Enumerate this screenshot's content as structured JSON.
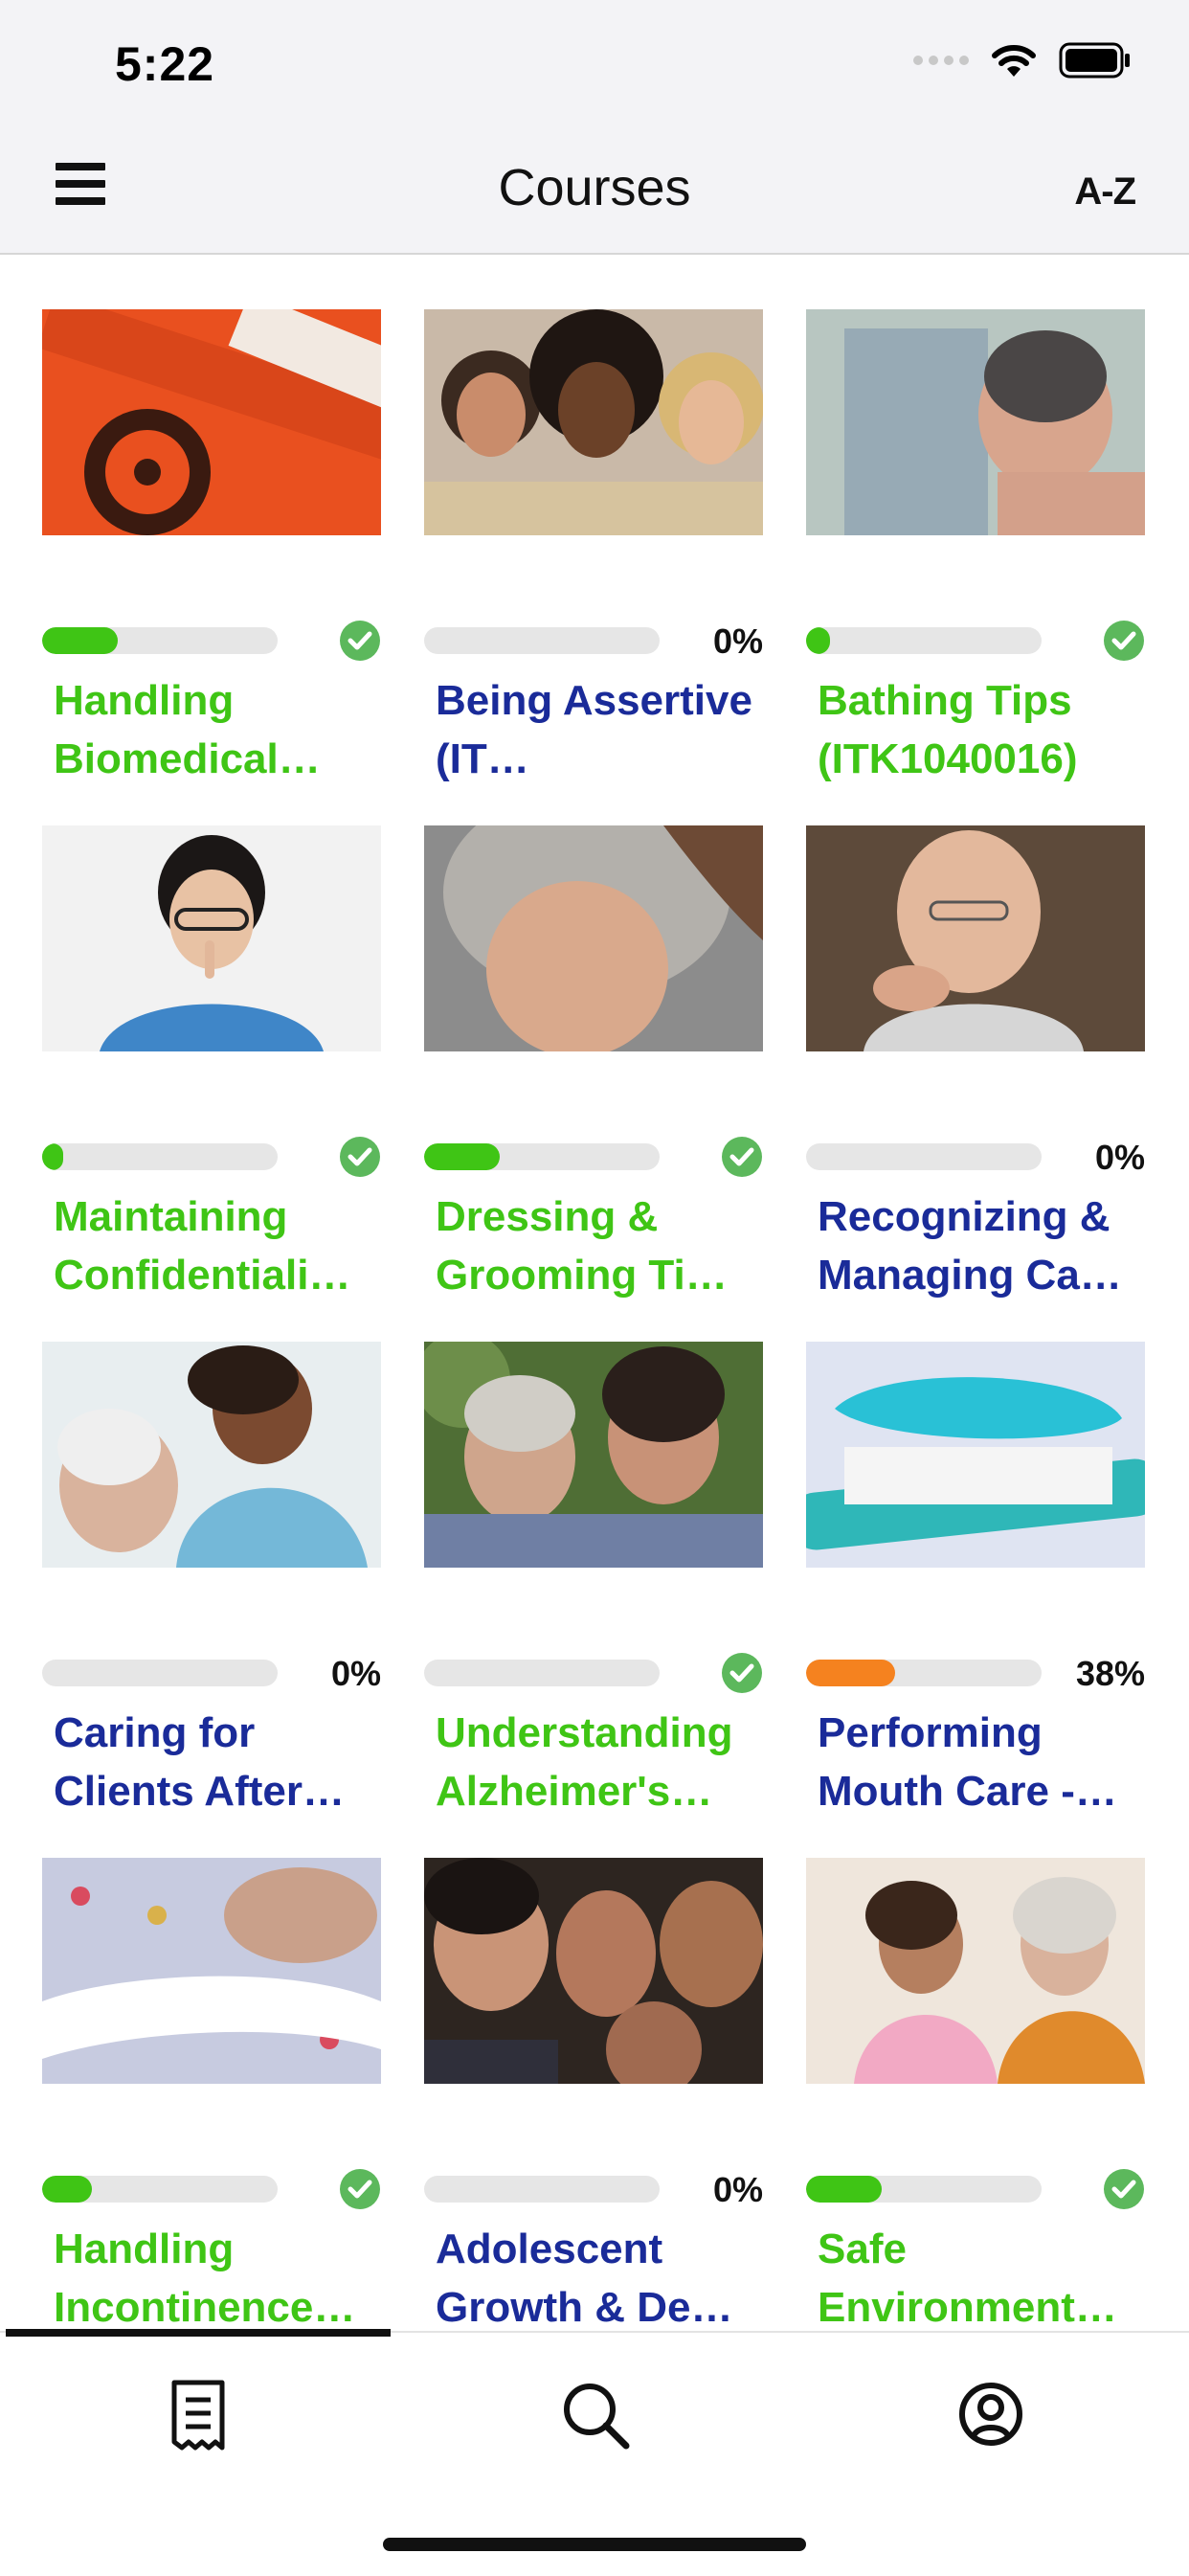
{
  "status_bar": {
    "time": "5:22"
  },
  "nav": {
    "title": "Courses",
    "sort_label": "A-Z"
  },
  "courses": [
    {
      "title": "Handling Biomedical…",
      "progress": 0.32,
      "status": "complete",
      "percent_label": "",
      "title_color": "#3fc515",
      "bar_color": "#3fc515",
      "image": "biohazard-bag"
    },
    {
      "title": "Being Assertive (IT…",
      "progress": 0.0,
      "status": "percent",
      "percent_label": "0%",
      "title_color": "#1a2b99",
      "bar_color": "#3fc515",
      "image": "three-women"
    },
    {
      "title": "Bathing Tips (ITK1040016)",
      "progress": 0.1,
      "status": "complete",
      "percent_label": "",
      "title_color": "#3fc515",
      "bar_color": "#3fc515",
      "image": "bathing-man"
    },
    {
      "title": "Maintaining Confidentiali…",
      "progress": 0.09,
      "status": "complete",
      "percent_label": "",
      "title_color": "#3fc515",
      "bar_color": "#3fc515",
      "image": "nurse-shush"
    },
    {
      "title": "Dressing & Grooming Ti…",
      "progress": 0.32,
      "status": "complete",
      "percent_label": "",
      "title_color": "#3fc515",
      "bar_color": "#3fc515",
      "image": "woman-hair-combed"
    },
    {
      "title": "Recognizing & Managing Ca…",
      "progress": 0.0,
      "status": "percent",
      "percent_label": "0%",
      "title_color": "#1a2b99",
      "bar_color": "#3fc515",
      "image": "elderly-man-pointing"
    },
    {
      "title": "Caring for Clients After…",
      "progress": 0.0,
      "status": "percent",
      "percent_label": "0%",
      "title_color": "#1a2b99",
      "bar_color": "#3fc515",
      "image": "nurse-with-patient"
    },
    {
      "title": "Understanding Alzheimer's…",
      "progress": 0.0,
      "status": "complete",
      "percent_label": "",
      "title_color": "#3fc515",
      "bar_color": "#3fc515",
      "image": "two-women-outdoors"
    },
    {
      "title": "Performing Mouth Care -…",
      "progress": 0.38,
      "status": "percent",
      "percent_label": "38%",
      "title_color": "#1a2b99",
      "bar_color": "#f5821f",
      "image": "toothbrush"
    },
    {
      "title": "Handling Incontinence…",
      "progress": 0.21,
      "status": "complete",
      "percent_label": "",
      "title_color": "#3fc515",
      "bar_color": "#3fc515",
      "image": "incontinence-pad"
    },
    {
      "title": "Adolescent Growth & De…",
      "progress": 0.0,
      "status": "percent",
      "percent_label": "0%",
      "title_color": "#1a2b99",
      "bar_color": "#3fc515",
      "image": "group-of-teens"
    },
    {
      "title": "Safe Environment…",
      "progress": 0.32,
      "status": "complete",
      "percent_label": "",
      "title_color": "#3fc515",
      "bar_color": "#3fc515",
      "image": "caregiver-with-elder"
    }
  ],
  "tabs": [
    {
      "name": "courses",
      "icon": "document-list-icon",
      "active": true
    },
    {
      "name": "search",
      "icon": "search-icon",
      "active": false
    },
    {
      "name": "profile",
      "icon": "user-circle-icon",
      "active": false
    }
  ],
  "colors": {
    "complete_green": "#3fc515",
    "incomplete_blue": "#1a2b99",
    "progress_orange": "#f5821f",
    "track_gray": "#e6e6e6"
  }
}
